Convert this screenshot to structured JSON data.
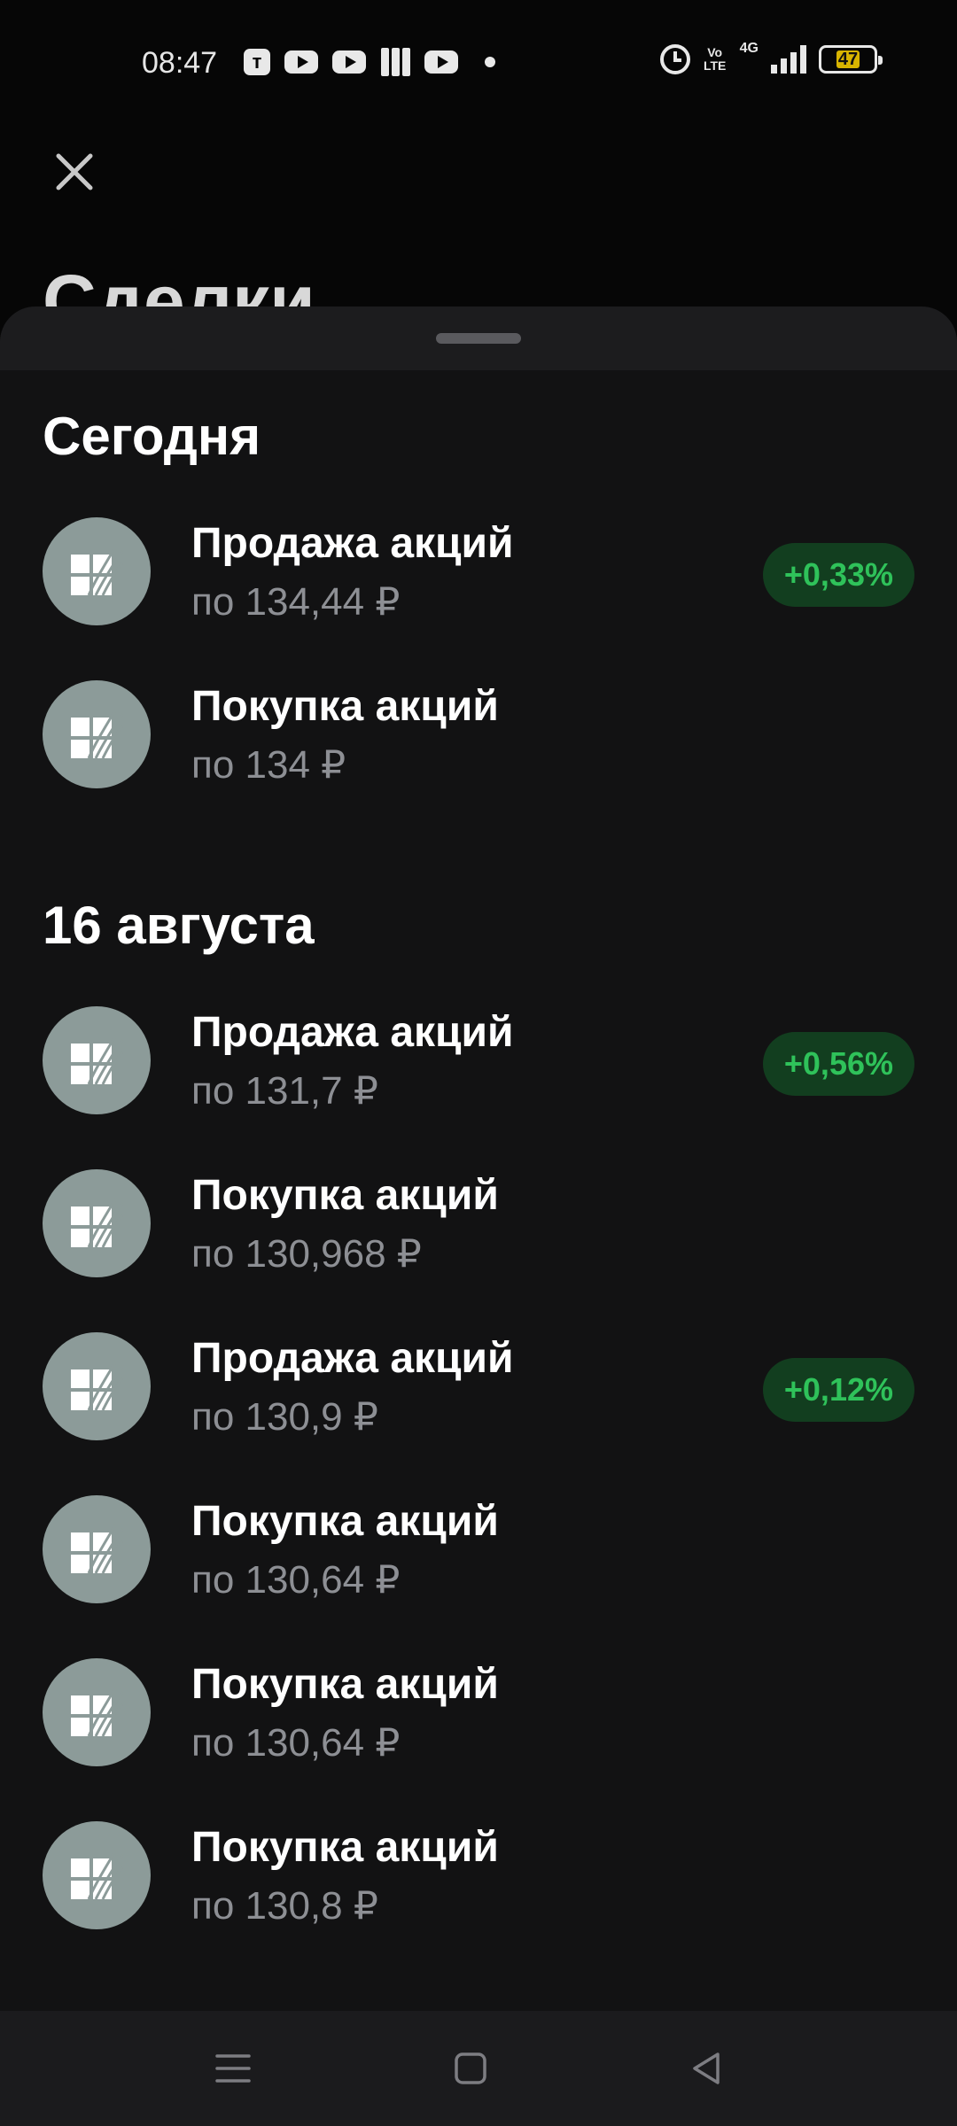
{
  "status_bar": {
    "time": "08:47",
    "battery_level": "47",
    "network": "4G",
    "volte": "Vo LTE",
    "icons_left": [
      "t-app-icon",
      "youtube-icon",
      "youtube-icon",
      "books-icon",
      "youtube-icon",
      "dot-icon"
    ],
    "icons_right": [
      "alarm-icon",
      "volte-icon",
      "signal-icon",
      "battery-icon"
    ]
  },
  "header": {
    "close_icon": "close-icon",
    "title": "Сделки"
  },
  "sections": [
    {
      "title": "Сегодня",
      "items": [
        {
          "title": "Продажа акций",
          "subtitle": "по 134,44 ₽",
          "badge": "+0,33%"
        },
        {
          "title": "Покупка акций",
          "subtitle": "по 134 ₽",
          "badge": ""
        }
      ]
    },
    {
      "title": "16 августа",
      "items": [
        {
          "title": "Продажа акций",
          "subtitle": "по 131,7 ₽",
          "badge": "+0,56%"
        },
        {
          "title": "Покупка акций",
          "subtitle": "по 130,968 ₽",
          "badge": ""
        },
        {
          "title": "Продажа акций",
          "subtitle": "по 130,9 ₽",
          "badge": "+0,12%"
        },
        {
          "title": "Покупка акций",
          "subtitle": "по 130,64 ₽",
          "badge": ""
        },
        {
          "title": "Покупка акций",
          "subtitle": "по 130,64 ₽",
          "badge": ""
        },
        {
          "title": "Покупка акций",
          "subtitle": "по 130,8 ₽",
          "badge": ""
        }
      ]
    }
  ],
  "colors": {
    "background": "#060606",
    "sheet": "#121213",
    "avatar": "#8c9b99",
    "badge_bg": "#123e1f",
    "badge_text": "#2fc25a",
    "subtitle": "#8d8f94"
  },
  "nav_bar": {
    "icons": [
      "menu-icon",
      "home-square-icon",
      "back-triangle-icon"
    ]
  }
}
